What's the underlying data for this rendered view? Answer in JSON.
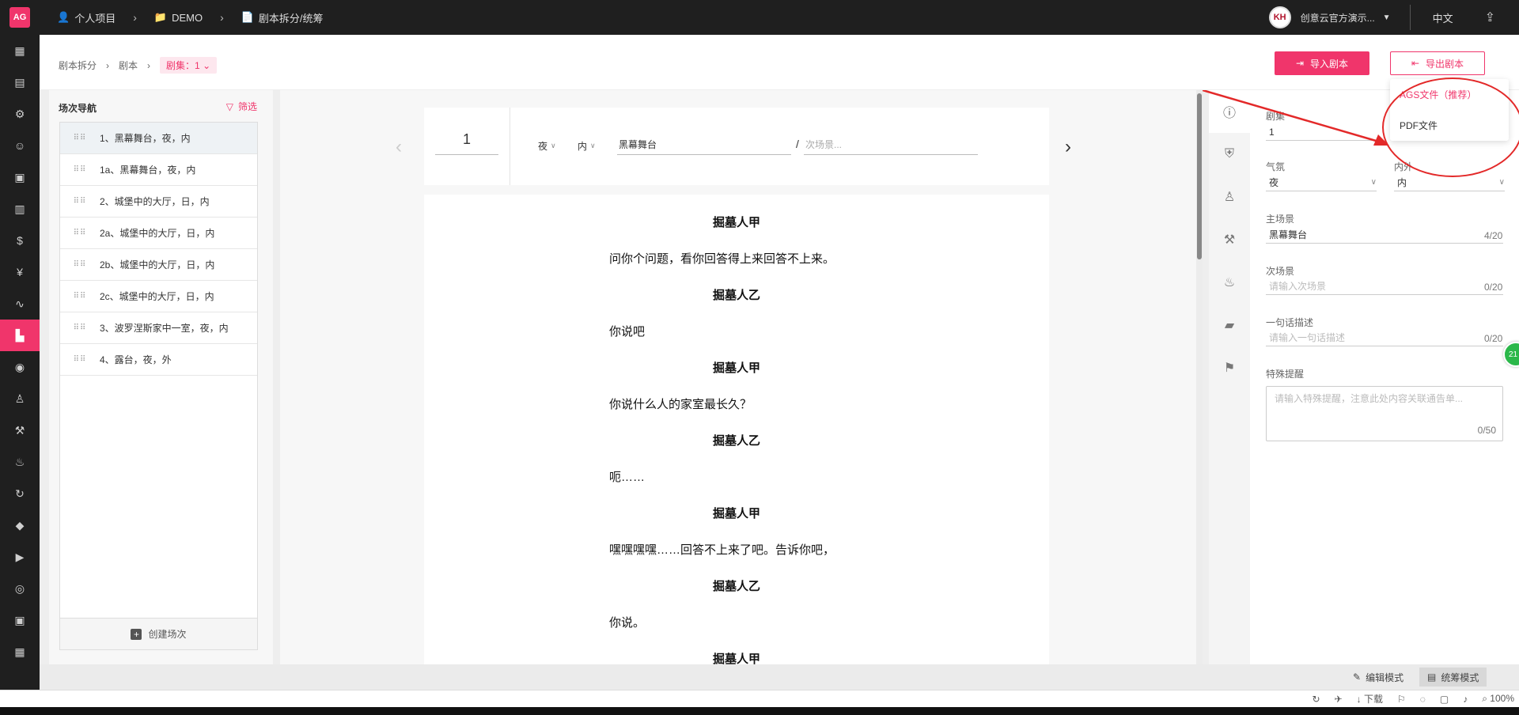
{
  "app": {
    "logo": "AG"
  },
  "breadcrumb": [
    {
      "icon": "user-icon",
      "label": "个人项目"
    },
    {
      "icon": "folder-icon",
      "label": "DEMO"
    },
    {
      "icon": "document-icon",
      "label": "剧本拆分/统筹"
    }
  ],
  "user": {
    "avatar": "KH",
    "name": "创意云官方演示..."
  },
  "language": "中文",
  "sidebar_icons": [
    "apps-icon",
    "document-list-icon",
    "settings-icon",
    "people-icon",
    "database-icon",
    "table-icon",
    "dollar-circle-icon",
    "yen-icon",
    "chart-icon",
    "script-icon",
    "location-icon",
    "costume-icon",
    "props-icon",
    "cake-icon",
    "sync-icon",
    "cube-icon",
    "video-icon",
    "target-icon",
    "media-icon",
    "film-icon"
  ],
  "page_breadcrumb": {
    "items": [
      "剧本拆分",
      "剧本"
    ],
    "episode_chip": "剧集：1"
  },
  "actions": {
    "import_label": "导入剧本",
    "export_label": "导出剧本"
  },
  "export_menu": [
    "AGS文件（推荐）",
    "PDF文件"
  ],
  "scene_nav": {
    "title": "场次导航",
    "filter_label": "筛选",
    "scenes": [
      "1、黑幕舞台，夜，内",
      "1a、黑幕舞台，夜，内",
      "2、城堡中的大厅，日，内",
      "2a、城堡中的大厅，日，内",
      "2b、城堡中的大厅，日，内",
      "2c、城堡中的大厅，日，内",
      "3、波罗涅斯家中一室，夜，内",
      "4、露台，夜，外"
    ],
    "create_label": "创建场次"
  },
  "scene_header": {
    "number": "1",
    "time": "夜",
    "interior": "内",
    "main_location": "黑幕舞台",
    "sub_location_placeholder": "次场景..."
  },
  "script_lines": [
    {
      "type": "character",
      "text": "掘墓人甲"
    },
    {
      "type": "dialogue",
      "text": "问你个问题，看你回答得上来回答不上来。"
    },
    {
      "type": "character",
      "text": "掘墓人乙"
    },
    {
      "type": "dialogue",
      "text": "你说吧"
    },
    {
      "type": "character",
      "text": "掘墓人甲"
    },
    {
      "type": "dialogue",
      "text": "你说什么人的家室最长久？"
    },
    {
      "type": "character",
      "text": "掘墓人乙"
    },
    {
      "type": "dialogue",
      "text": "呃……"
    },
    {
      "type": "character",
      "text": "掘墓人甲"
    },
    {
      "type": "dialogue",
      "text": "嘿嘿嘿嘿……回答不上来了吧。告诉你吧，"
    },
    {
      "type": "character",
      "text": "掘墓人乙"
    },
    {
      "type": "dialogue",
      "text": "你说。"
    },
    {
      "type": "character",
      "text": "掘墓人甲"
    }
  ],
  "right_tabs": [
    "info-icon",
    "shield-icon",
    "costume-icon",
    "props-icon",
    "cake-icon",
    "folder-icon",
    "flag-icon"
  ],
  "properties": {
    "episode_label": "剧集",
    "episode_value": "1",
    "mood_label": "气氛",
    "mood_value": "夜",
    "inout_label": "内外",
    "inout_value": "内",
    "main_label": "主场景",
    "main_value": "黑幕舞台",
    "main_count": "4/20",
    "sub_label": "次场景",
    "sub_placeholder": "请输入次场景",
    "sub_count": "0/20",
    "summary_label": "一句话描述",
    "summary_placeholder": "请输入一句话描述",
    "summary_count": "0/20",
    "notice_label": "特殊提醒",
    "notice_placeholder": "请输入特殊提醒，注意此处内容关联通告单...",
    "notice_count": "0/50",
    "badge": "21"
  },
  "modes": {
    "edit": "编辑模式",
    "plan": "统筹模式"
  },
  "status": {
    "download": "下载",
    "zoom": "100%"
  },
  "colors": {
    "accent": "#f0356b",
    "dark": "#1f1f1f",
    "annotation": "#e32929"
  }
}
